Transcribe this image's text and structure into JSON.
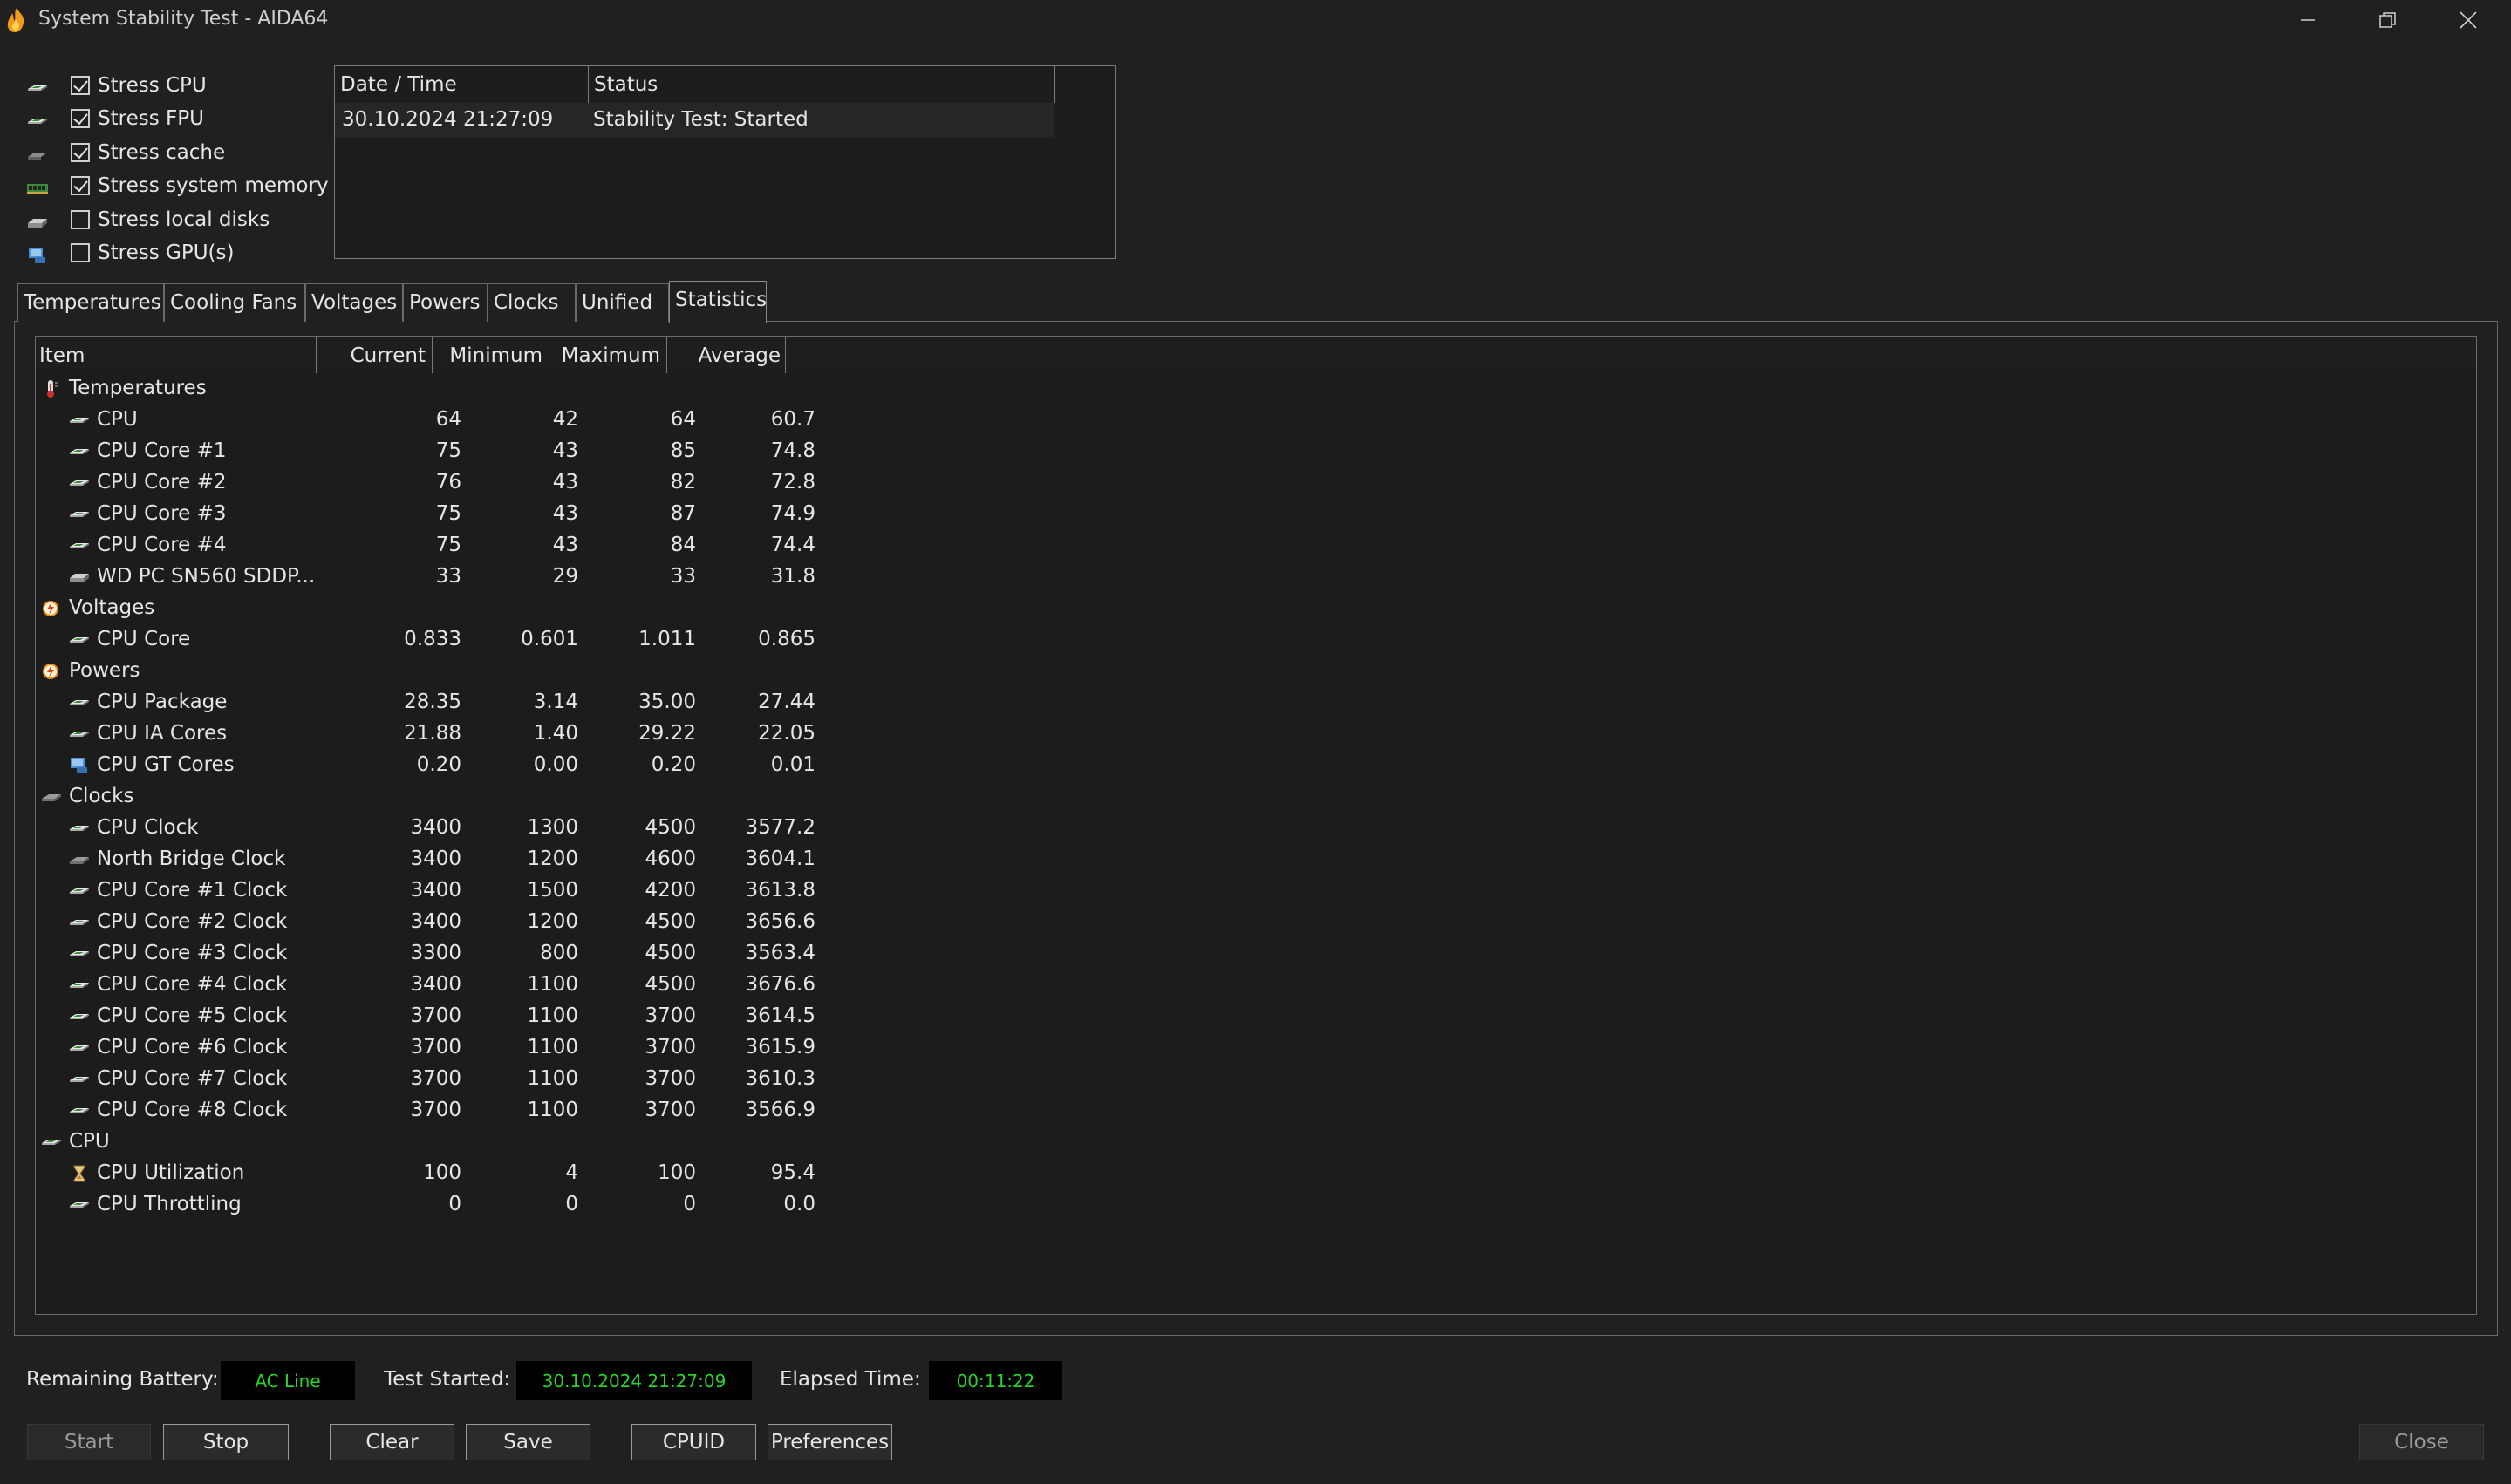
{
  "window": {
    "title": "System Stability Test - AIDA64"
  },
  "stress_options": [
    {
      "label": "Stress CPU",
      "checked": true,
      "icon": "cpu-chip-icon"
    },
    {
      "label": "Stress FPU",
      "checked": true,
      "icon": "fpu-chip-icon"
    },
    {
      "label": "Stress cache",
      "checked": true,
      "icon": "cache-icon"
    },
    {
      "label": "Stress system memory",
      "checked": true,
      "icon": "memory-module-icon"
    },
    {
      "label": "Stress local disks",
      "checked": false,
      "icon": "disk-drive-icon"
    },
    {
      "label": "Stress GPU(s)",
      "checked": false,
      "icon": "gpu-monitor-icon"
    }
  ],
  "log": {
    "headers": [
      "Date / Time",
      "Status"
    ],
    "rows": [
      {
        "datetime": "30.10.2024 21:27:09",
        "status": "Stability Test: Started"
      }
    ]
  },
  "tabs": [
    "Temperatures",
    "Cooling Fans",
    "Voltages",
    "Powers",
    "Clocks",
    "Unified",
    "Statistics"
  ],
  "active_tab": "Statistics",
  "stats": {
    "headers": {
      "item": "Item",
      "current": "Current",
      "minimum": "Minimum",
      "maximum": "Maximum",
      "average": "Average"
    },
    "groups": [
      {
        "name": "Temperatures",
        "icon": "thermometer-icon",
        "rows": [
          {
            "name": "CPU",
            "icon": "cpu-chip-icon",
            "current": "64",
            "minimum": "42",
            "maximum": "64",
            "average": "60.7"
          },
          {
            "name": "CPU Core #1",
            "icon": "cpu-chip-icon",
            "current": "75",
            "minimum": "43",
            "maximum": "85",
            "average": "74.8"
          },
          {
            "name": "CPU Core #2",
            "icon": "cpu-chip-icon",
            "current": "76",
            "minimum": "43",
            "maximum": "82",
            "average": "72.8"
          },
          {
            "name": "CPU Core #3",
            "icon": "cpu-chip-icon",
            "current": "75",
            "minimum": "43",
            "maximum": "87",
            "average": "74.9"
          },
          {
            "name": "CPU Core #4",
            "icon": "cpu-chip-icon",
            "current": "75",
            "minimum": "43",
            "maximum": "84",
            "average": "74.4"
          },
          {
            "name": "WD PC SN560 SDDP...",
            "icon": "disk-drive-icon",
            "current": "33",
            "minimum": "29",
            "maximum": "33",
            "average": "31.8"
          }
        ]
      },
      {
        "name": "Voltages",
        "icon": "voltage-icon",
        "rows": [
          {
            "name": "CPU Core",
            "icon": "cpu-chip-icon",
            "current": "0.833",
            "minimum": "0.601",
            "maximum": "1.011",
            "average": "0.865"
          }
        ]
      },
      {
        "name": "Powers",
        "icon": "power-icon",
        "rows": [
          {
            "name": "CPU Package",
            "icon": "cpu-chip-icon",
            "current": "28.35",
            "minimum": "3.14",
            "maximum": "35.00",
            "average": "27.44"
          },
          {
            "name": "CPU IA Cores",
            "icon": "cpu-chip-icon",
            "current": "21.88",
            "minimum": "1.40",
            "maximum": "29.22",
            "average": "22.05"
          },
          {
            "name": "CPU GT Cores",
            "icon": "gpu-monitor-icon",
            "current": "0.20",
            "minimum": "0.00",
            "maximum": "0.20",
            "average": "0.01"
          }
        ]
      },
      {
        "name": "Clocks",
        "icon": "chipset-icon",
        "rows": [
          {
            "name": "CPU Clock",
            "icon": "cpu-chip-icon",
            "current": "3400",
            "minimum": "1300",
            "maximum": "4500",
            "average": "3577.2"
          },
          {
            "name": "North Bridge Clock",
            "icon": "chipset-icon",
            "current": "3400",
            "minimum": "1200",
            "maximum": "4600",
            "average": "3604.1"
          },
          {
            "name": "CPU Core #1 Clock",
            "icon": "cpu-chip-icon",
            "current": "3400",
            "minimum": "1500",
            "maximum": "4200",
            "average": "3613.8"
          },
          {
            "name": "CPU Core #2 Clock",
            "icon": "cpu-chip-icon",
            "current": "3400",
            "minimum": "1200",
            "maximum": "4500",
            "average": "3656.6"
          },
          {
            "name": "CPU Core #3 Clock",
            "icon": "cpu-chip-icon",
            "current": "3300",
            "minimum": "800",
            "maximum": "4500",
            "average": "3563.4"
          },
          {
            "name": "CPU Core #4 Clock",
            "icon": "cpu-chip-icon",
            "current": "3400",
            "minimum": "1100",
            "maximum": "4500",
            "average": "3676.6"
          },
          {
            "name": "CPU Core #5 Clock",
            "icon": "cpu-chip-icon",
            "current": "3700",
            "minimum": "1100",
            "maximum": "3700",
            "average": "3614.5"
          },
          {
            "name": "CPU Core #6 Clock",
            "icon": "cpu-chip-icon",
            "current": "3700",
            "minimum": "1100",
            "maximum": "3700",
            "average": "3615.9"
          },
          {
            "name": "CPU Core #7 Clock",
            "icon": "cpu-chip-icon",
            "current": "3700",
            "minimum": "1100",
            "maximum": "3700",
            "average": "3610.3"
          },
          {
            "name": "CPU Core #8 Clock",
            "icon": "cpu-chip-icon",
            "current": "3700",
            "minimum": "1100",
            "maximum": "3700",
            "average": "3566.9"
          }
        ]
      },
      {
        "name": "CPU",
        "icon": "cpu-chip-icon",
        "rows": [
          {
            "name": "CPU Utilization",
            "icon": "hourglass-icon",
            "current": "100",
            "minimum": "4",
            "maximum": "100",
            "average": "95.4"
          },
          {
            "name": "CPU Throttling",
            "icon": "cpu-chip-icon",
            "current": "0",
            "minimum": "0",
            "maximum": "0",
            "average": "0.0"
          }
        ]
      }
    ]
  },
  "status_bar": {
    "battery_label": "Remaining Battery:",
    "battery_value": "AC Line",
    "started_label": "Test Started:",
    "started_value": "30.10.2024 21:27:09",
    "elapsed_label": "Elapsed Time:",
    "elapsed_value": "00:11:22"
  },
  "buttons": {
    "start": "Start",
    "stop": "Stop",
    "clear": "Clear",
    "save": "Save",
    "cpuid": "CPUID",
    "preferences": "Preferences",
    "close": "Close"
  },
  "colors": {
    "background": "#202020",
    "status_text": "#28d428",
    "status_box": "#000000"
  }
}
